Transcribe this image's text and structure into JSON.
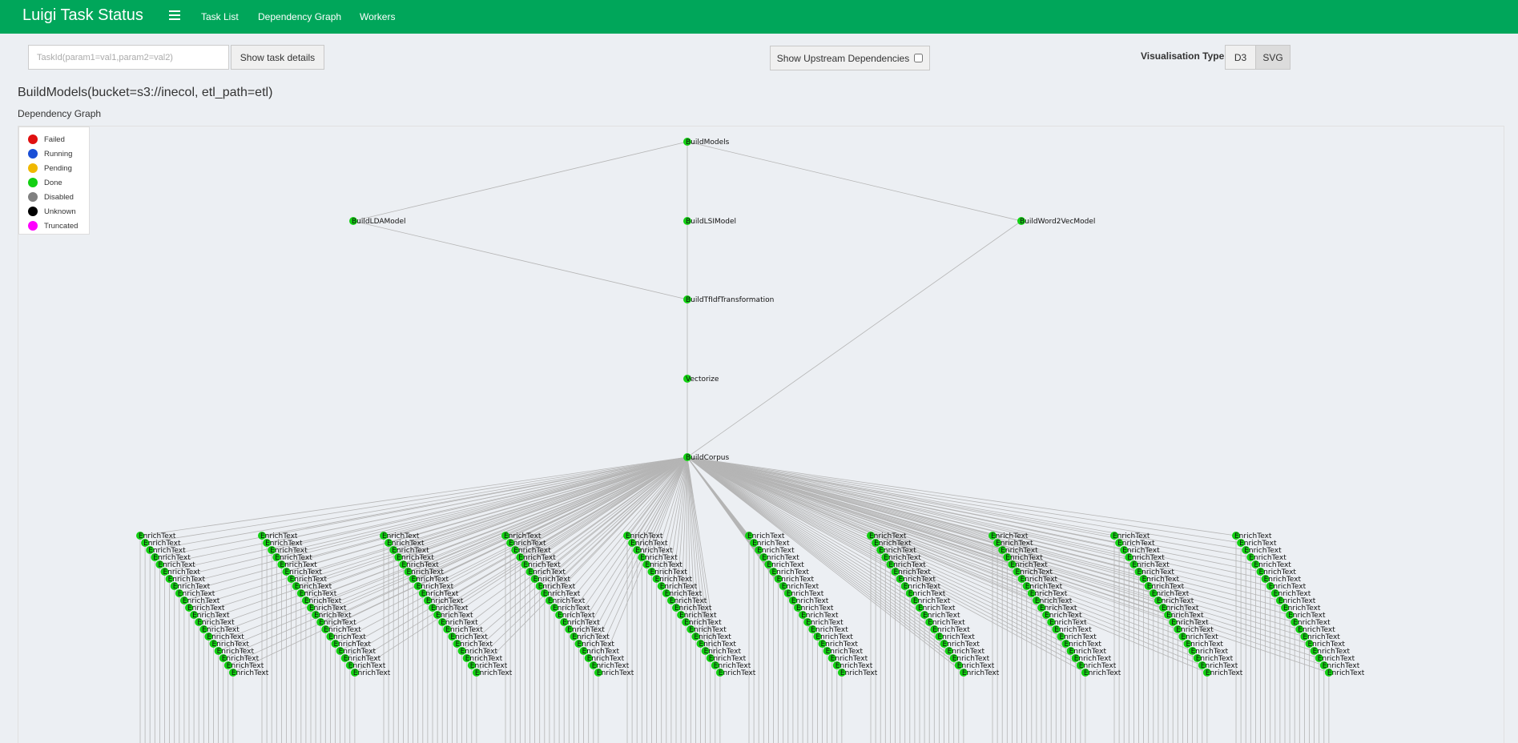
{
  "navbar": {
    "brand": "Luigi Task Status",
    "links": [
      "Task List",
      "Dependency Graph",
      "Workers"
    ]
  },
  "controls": {
    "task_input_placeholder": "TaskId(param1=val1,param2=val2)",
    "show_details_label": "Show task details",
    "upstream_label": "Show Upstream Dependencies",
    "upstream_checked": false,
    "visualisation_label": "Visualisation Type",
    "vis_options": [
      "D3",
      "SVG"
    ],
    "vis_selected": "SVG"
  },
  "page": {
    "title": "BuildModels(bucket=s3://inecol, etl_path=etl)",
    "graph_label": "Dependency Graph"
  },
  "legend": [
    {
      "label": "Failed",
      "color": "#e01010"
    },
    {
      "label": "Running",
      "color": "#1a4fd6"
    },
    {
      "label": "Pending",
      "color": "#f0b800"
    },
    {
      "label": "Done",
      "color": "#12d012"
    },
    {
      "label": "Disabled",
      "color": "#808080"
    },
    {
      "label": "Unknown",
      "color": "#000000"
    },
    {
      "label": "Truncated",
      "color": "#ff00ff"
    }
  ],
  "graph": {
    "node_color": "#12d012",
    "edge_color": "#b5b5b5",
    "nodes": [
      {
        "name": "BuildModels",
        "status": "Done"
      },
      {
        "name": "BuildLDAModel",
        "status": "Done"
      },
      {
        "name": "BuildLSIModel",
        "status": "Done"
      },
      {
        "name": "BuildWord2VecModel",
        "status": "Done"
      },
      {
        "name": "BuildTfIdfTransformation",
        "status": "Done"
      },
      {
        "name": "Vectorize",
        "status": "Done"
      },
      {
        "name": "BuildCorpus",
        "status": "Done"
      }
    ],
    "edges": [
      [
        "BuildModels",
        "BuildLDAModel"
      ],
      [
        "BuildModels",
        "BuildLSIModel"
      ],
      [
        "BuildModels",
        "BuildWord2VecModel"
      ],
      [
        "BuildLDAModel",
        "BuildTfIdfTransformation"
      ],
      [
        "BuildLSIModel",
        "BuildTfIdfTransformation"
      ],
      [
        "BuildTfIdfTransformation",
        "Vectorize"
      ],
      [
        "Vectorize",
        "BuildCorpus"
      ],
      [
        "BuildWord2VecModel",
        "BuildCorpus"
      ]
    ],
    "leaf_task_name": "EnrichText",
    "leaf_status": "Done",
    "leaf_parent": "BuildCorpus",
    "leaf_group_count": 10,
    "leaf_group_sizes": [
      20,
      20,
      20,
      20,
      20,
      20,
      20,
      20,
      20,
      20
    ]
  }
}
